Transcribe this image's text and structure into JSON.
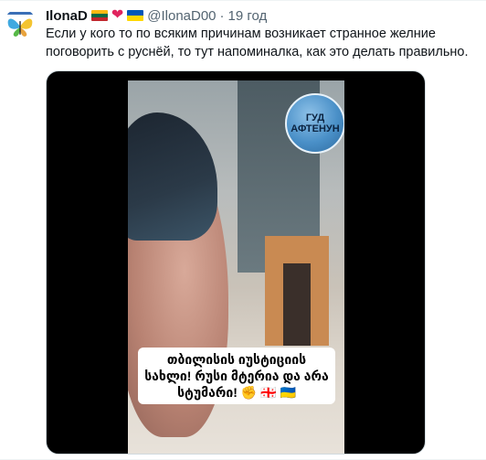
{
  "tweet": {
    "author": {
      "display_name": "IlonaD",
      "handle": "@IlonaD00",
      "badges": [
        "flag-lithuania-icon",
        "heart-icon",
        "flag-ukraine-icon"
      ]
    },
    "separator": "·",
    "time": "19 год",
    "text": "Если у кого то по всяким причинам возникает странное желние поговорить с руснёй, то тут напоминалка, как это делать правильно.",
    "media": {
      "logo_line1": "ГУД",
      "logo_line2": "АФТЕНУН",
      "caption": "თბილისის იუსტიციის სახლი! რუსი მტერია და არა სტუმარი! ✊ 🇬🇪 🇺🇦"
    }
  },
  "colors": {
    "name": "#0f1419",
    "secondary": "#536471",
    "media_bg": "#000000",
    "heart": "#e0245e"
  }
}
